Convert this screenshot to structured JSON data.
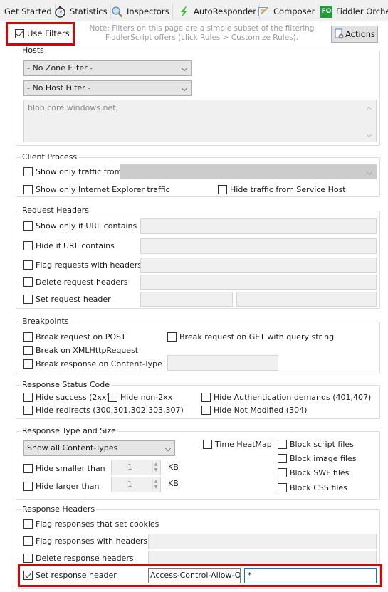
{
  "tabs": [
    {
      "label": "Get Started",
      "icon": "none"
    },
    {
      "label": "Statistics",
      "icon": "stopwatch-icon"
    },
    {
      "label": "Inspectors",
      "icon": "magnifier-icon"
    },
    {
      "label": "AutoResponder",
      "icon": "lightning-icon"
    },
    {
      "label": "Composer",
      "icon": "compose-pencil-icon"
    },
    {
      "label": "Fiddler Orches",
      "icon": "fo-badge-icon",
      "badge": "FO"
    }
  ],
  "top": {
    "use_filters_label": "Use Filters",
    "use_filters_checked": true,
    "note_line1": "Note: Filters on this page are a simple subset of the filtering",
    "note_line2": "FiddlerScript offers (click Rules > Customize Rules).",
    "actions_label": "Actions"
  },
  "hosts": {
    "title": "Hosts",
    "zone_filter": "- No Zone Filter -",
    "host_filter": "- No Host Filter -",
    "hosts_text": "blob.core.windows.net;"
  },
  "client_process": {
    "title": "Client Process",
    "show_only_from": "Show only traffic from",
    "show_only_ie": "Show only Internet Explorer traffic",
    "hide_service_host": "Hide traffic from Service Host"
  },
  "request_headers": {
    "title": "Request Headers",
    "show_if_url": "Show only if URL contains",
    "hide_if_url": "Hide if URL contains",
    "flag_with_headers": "Flag requests with headers",
    "delete_headers": "Delete request headers",
    "set_header": "Set request header"
  },
  "breakpoints": {
    "title": "Breakpoints",
    "on_post": "Break request on POST",
    "on_get_query": "Break request on GET with query string",
    "on_xhr": "Break on XMLHttpRequest",
    "on_content_type": "Break response on Content-Type"
  },
  "status_code": {
    "title": "Response Status Code",
    "hide_success": "Hide success (2xx)",
    "hide_non2xx": "Hide non-2xx",
    "hide_auth": "Hide Authentication demands (401,407)",
    "hide_redirects": "Hide redirects (300,301,302,303,307)",
    "hide_not_modified": "Hide Not Modified (304)"
  },
  "type_size": {
    "title": "Response Type and Size",
    "content_type": "Show all Content-Types",
    "hide_smaller": "Hide smaller than",
    "hide_larger": "Hide larger than",
    "smaller_value": "1",
    "larger_value": "1",
    "unit": "KB",
    "time_heatmap": "Time HeatMap",
    "block_script": "Block script files",
    "block_image": "Block image files",
    "block_swf": "Block SWF files",
    "block_css": "Block CSS files"
  },
  "response_headers": {
    "title": "Response Headers",
    "flag_cookies": "Flag responses that set cookies",
    "flag_with_headers": "Flag responses with headers",
    "delete_headers": "Delete response headers",
    "set_header": "Set response header",
    "set_header_checked": true,
    "set_header_name": "Access-Control-Allow-Ori",
    "set_header_value": "*"
  },
  "colors": {
    "highlight": "#e00000",
    "focus_border": "#0078d7"
  }
}
